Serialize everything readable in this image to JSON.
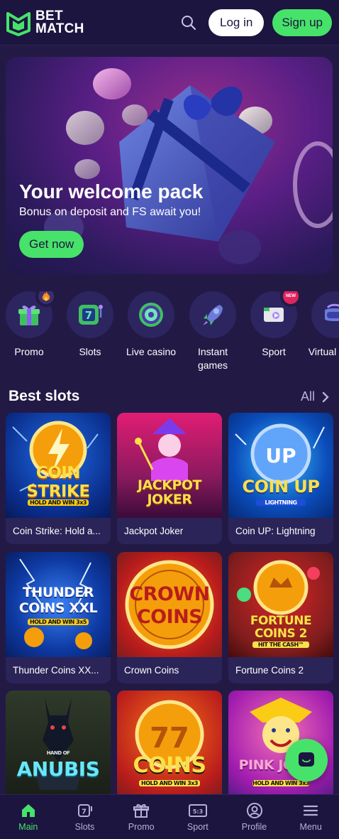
{
  "header": {
    "logo_line1": "BET",
    "logo_line2": "MATCH",
    "login_label": "Log in",
    "signup_label": "Sign up"
  },
  "hero": {
    "title": "Your welcome pack",
    "subtitle": "Bonus on deposit and FS await you!",
    "cta_label": "Get now"
  },
  "categories": [
    {
      "label": "Promo",
      "icon": "gift-icon",
      "badge": "fire-icon"
    },
    {
      "label": "Slots",
      "icon": "slot-machine-icon"
    },
    {
      "label": "Live casino",
      "icon": "roulette-icon"
    },
    {
      "label": "Instant games",
      "icon": "rocket-icon"
    },
    {
      "label": "Sport",
      "icon": "sport-tv-icon",
      "badge_text": "NEW"
    },
    {
      "label": "Virtual sport",
      "icon": "vr-headset-icon"
    }
  ],
  "best_slots": {
    "title": "Best slots",
    "all_label": "All",
    "games": [
      {
        "name": "Coin Strike: Hold a...",
        "art_text": "COIN STRIKE",
        "art_sub": "HOLD AND WIN 3x3"
      },
      {
        "name": "Jackpot Joker",
        "art_text": "JACKPOT JOKER"
      },
      {
        "name": "Coin UP: Lightning",
        "art_text": "COIN UP",
        "art_sub": "LIGHTNING"
      },
      {
        "name": "Thunder Coins XX...",
        "art_text": "THUNDER COINS XXL",
        "art_sub": "HOLD AND WIN 3x5"
      },
      {
        "name": "Crown Coins",
        "art_text": "CROWN COINS"
      },
      {
        "name": "Fortune Coins 2",
        "art_text": "FORTUNE COINS 2",
        "art_sub": "HIT THE CASH™"
      },
      {
        "name": "",
        "art_text": "ANUBIS",
        "art_sub": "HAND OF"
      },
      {
        "name": "",
        "art_text": "COINS",
        "art_sub": "HOLD AND WIN 3x3"
      },
      {
        "name": "",
        "art_text": "PINK JOKER",
        "art_sub": "HOLD AND WIN 3x3"
      }
    ]
  },
  "bottom_nav": [
    {
      "label": "Main",
      "icon": "home-icon",
      "active": true
    },
    {
      "label": "Slots",
      "icon": "slot-icon"
    },
    {
      "label": "Promo",
      "icon": "gift-icon"
    },
    {
      "label": "Sport",
      "icon": "scoreboard-icon"
    },
    {
      "label": "Profile",
      "icon": "profile-icon"
    },
    {
      "label": "Menu",
      "icon": "menu-icon"
    }
  ],
  "colors": {
    "background": "#221a45",
    "header": "#1b1540",
    "accent_green": "#47e26a",
    "card": "#2b2458"
  }
}
